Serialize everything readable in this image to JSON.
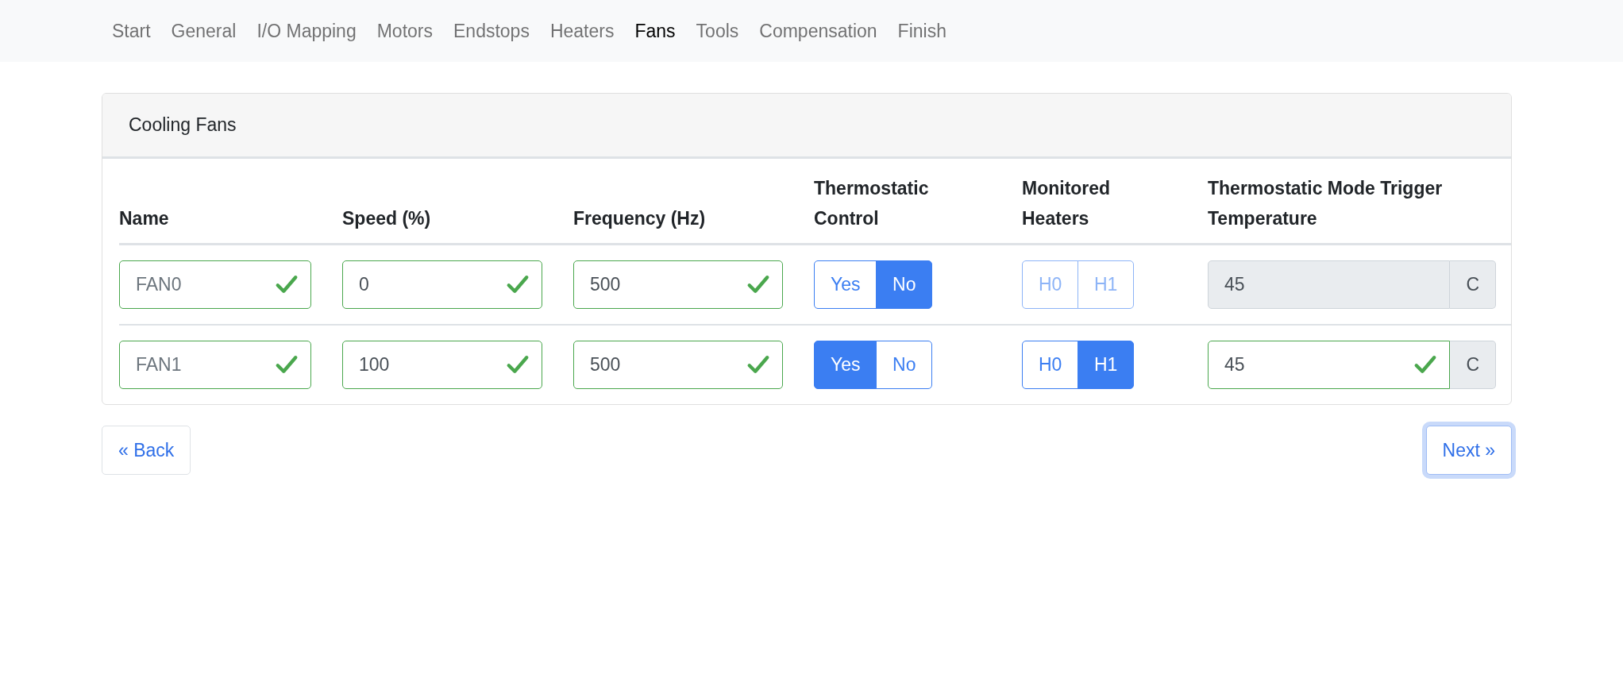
{
  "nav": {
    "items": [
      {
        "label": "Start",
        "selected": false
      },
      {
        "label": "General",
        "selected": false
      },
      {
        "label": "I/O Mapping",
        "selected": false
      },
      {
        "label": "Motors",
        "selected": false
      },
      {
        "label": "Endstops",
        "selected": false
      },
      {
        "label": "Heaters",
        "selected": false
      },
      {
        "label": "Fans",
        "selected": true
      },
      {
        "label": "Tools",
        "selected": false
      },
      {
        "label": "Compensation",
        "selected": false
      },
      {
        "label": "Finish",
        "selected": false
      }
    ]
  },
  "card": {
    "title": "Cooling Fans",
    "columns": [
      "Name",
      "Speed (%)",
      "Frequency (Hz)",
      "Thermostatic Control",
      "Monitored Heaters",
      "Thermostatic Mode Trigger Temperature"
    ],
    "rows": [
      {
        "name": {
          "placeholder": "FAN0",
          "valid": true
        },
        "speed": {
          "value": "0",
          "valid": true
        },
        "frequency": {
          "value": "500",
          "valid": true
        },
        "thermostatic": [
          {
            "label": "Yes",
            "selected": false
          },
          {
            "label": "No",
            "selected": true
          }
        ],
        "heaters": {
          "disabled": true,
          "options": [
            {
              "label": "H0",
              "selected": false
            },
            {
              "label": "H1",
              "selected": false
            }
          ]
        },
        "trigger": {
          "value": "45",
          "disabled": true,
          "valid": false,
          "unit": "C"
        }
      },
      {
        "name": {
          "placeholder": "FAN1",
          "valid": true
        },
        "speed": {
          "value": "100",
          "valid": true
        },
        "frequency": {
          "value": "500",
          "valid": true
        },
        "thermostatic": [
          {
            "label": "Yes",
            "selected": true
          },
          {
            "label": "No",
            "selected": false
          }
        ],
        "heaters": {
          "disabled": false,
          "options": [
            {
              "label": "H0",
              "selected": false
            },
            {
              "label": "H1",
              "selected": true
            }
          ]
        },
        "trigger": {
          "value": "45",
          "disabled": false,
          "valid": true,
          "unit": "C"
        }
      }
    ]
  },
  "back": {
    "label": "« Back"
  },
  "next": {
    "label": "Next »",
    "focused": true
  }
}
